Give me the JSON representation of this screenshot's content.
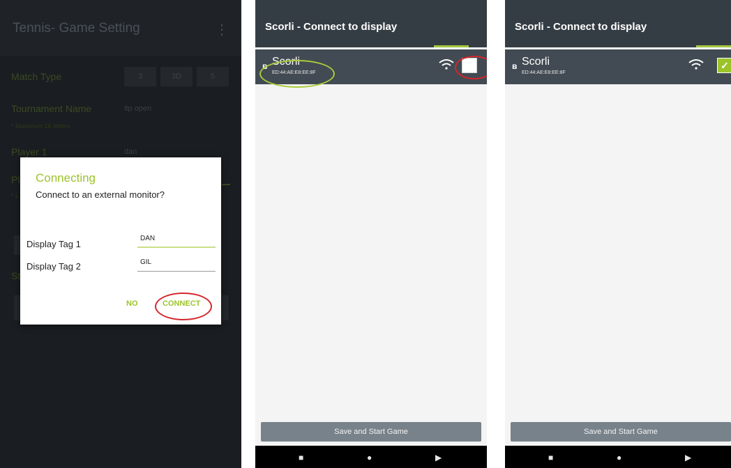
{
  "panel1": {
    "title": "Tennis- Game Setting",
    "menu_icon": "more-vert-icon",
    "match_type": {
      "label": "Match Type",
      "options": [
        "3",
        "3D",
        "5"
      ]
    },
    "tournament": {
      "label": "Tournament Name",
      "value": "itp open",
      "hint": "* Maximum 16 letters"
    },
    "player1": {
      "label": "Player 1",
      "value": "dan"
    },
    "player2_partial": "Pl",
    "hint_partial": "* L",
    "section_partial": "St",
    "dialog": {
      "title": "Connecting",
      "message": "Connect to an external monitor?",
      "tag1": {
        "label": "Display Tag 1",
        "value": "DAN"
      },
      "tag2": {
        "label": "Display Tag 2",
        "value": "GIL"
      },
      "no_label": "NO",
      "connect_label": "CONNECT"
    }
  },
  "panel2": {
    "title": "Scorli - Connect to display",
    "device": {
      "name": "Scorli",
      "mac": "ED:44:AE:E8:EE:8F",
      "bt_icon": "bluetooth-icon",
      "wifi_icon": "wifi-icon"
    },
    "checked": false,
    "save_label": "Save and Start Game"
  },
  "panel3": {
    "title": "Scorli - Connect to display",
    "device": {
      "name": "Scorli",
      "mac": "ED:44:AE:E8:EE:8F",
      "bt_icon": "bluetooth-icon",
      "wifi_icon": "wifi-icon"
    },
    "checked": true,
    "check_glyph": "✓",
    "save_label": "Save and Start Game"
  },
  "nav": {
    "recents": "■",
    "home": "●",
    "back": "▶"
  },
  "colors": {
    "accent": "#9cc42a",
    "appbar": "#353d44",
    "device_row": "#424b53",
    "highlight_red": "#d3262b",
    "highlight_green": "#a9cc3a"
  }
}
